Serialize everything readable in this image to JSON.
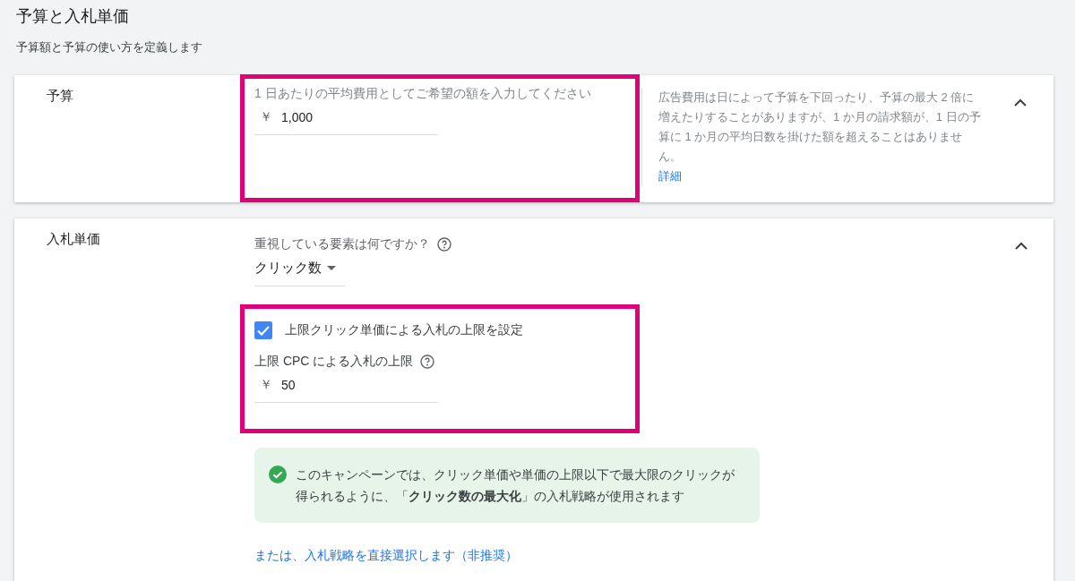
{
  "header": {
    "title": "予算と入札単価",
    "subtitle": "予算額と予算の使い方を定義します"
  },
  "budget": {
    "label": "予算",
    "field_label": "1 日あたりの平均費用としてご希望の額を入力してください",
    "currency": "￥",
    "value": "1,000",
    "help_text": "広告費用は日によって予算を下回ったり、予算の最大 2 倍に増えたりすることがありますが、1 か月の請求額が、1 日の予算に 1 か月の平均日数を掛けた額を超えることはありません。",
    "help_link": "詳細",
    "expanded": true
  },
  "bidding": {
    "label": "入札単価",
    "question": "重視している要素は何ですか？",
    "dropdown_value": "クリック数",
    "expanded": true,
    "max_cpc_checkbox": {
      "label": "上限クリック単価による入札の上限を設定",
      "checked": true
    },
    "max_cpc_label": "上限 CPC による入札の上限",
    "currency": "￥",
    "value": "50",
    "info": "このキャンペーンでは、クリック単価や単価の上限以下で最大限のクリックが得られるように、「**クリック数の最大化**」の入札戦略が使用されます",
    "link": "または、入札戦略を直接選択します（非推奨）"
  }
}
